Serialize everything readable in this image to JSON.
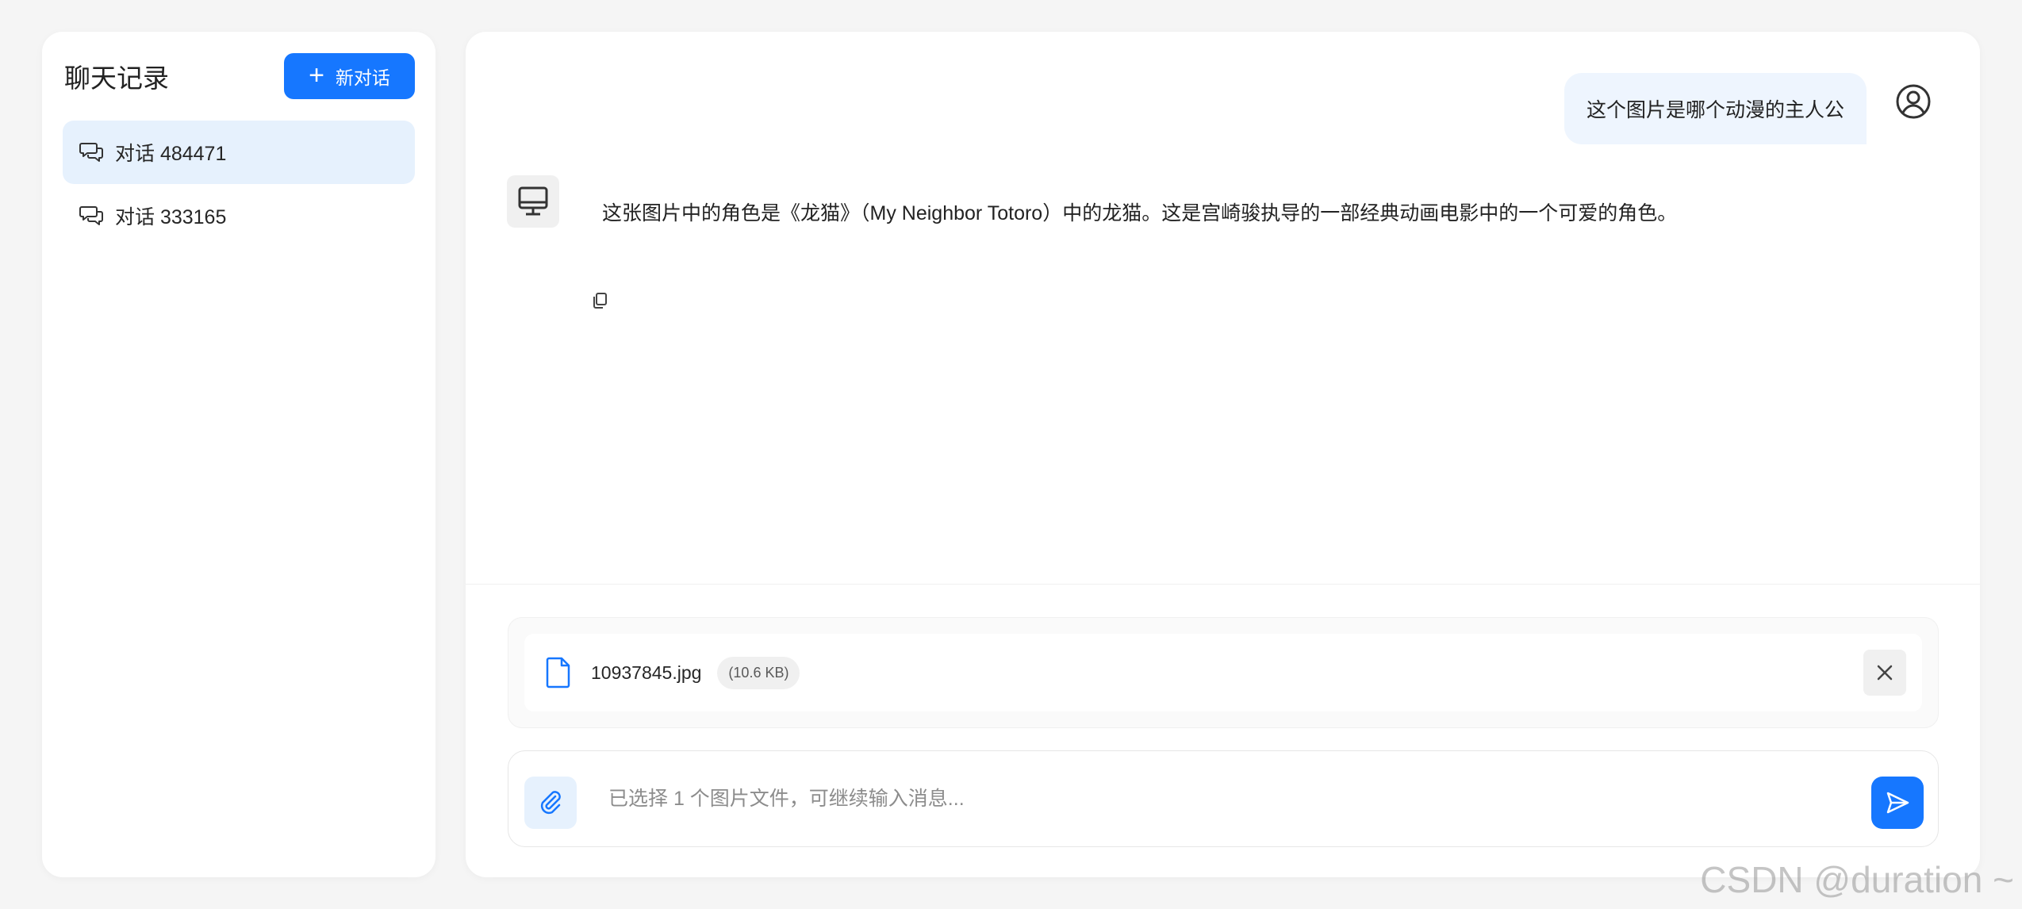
{
  "sidebar": {
    "title": "聊天记录",
    "new_chat_label": "新对话",
    "conversations": [
      {
        "label": "对话 484471",
        "active": true
      },
      {
        "label": "对话 333165",
        "active": false
      }
    ]
  },
  "chat": {
    "user_message": "这个图片是哪个动漫的主人公",
    "bot_message": "这张图片中的角色是《龙猫》（My Neighbor Totoro）中的龙猫。这是宫崎骏执导的一部经典动画电影中的一个可爱的角色。"
  },
  "attachment": {
    "file_name": "10937845.jpg",
    "file_size": "(10.6 KB)"
  },
  "composer": {
    "placeholder": "已选择 1 个图片文件，可继续输入消息..."
  },
  "watermark": "CSDN @duration ~",
  "colors": {
    "accent": "#1677ff",
    "active_bg": "#e6f1fd",
    "user_bubble": "#eef5fe"
  }
}
